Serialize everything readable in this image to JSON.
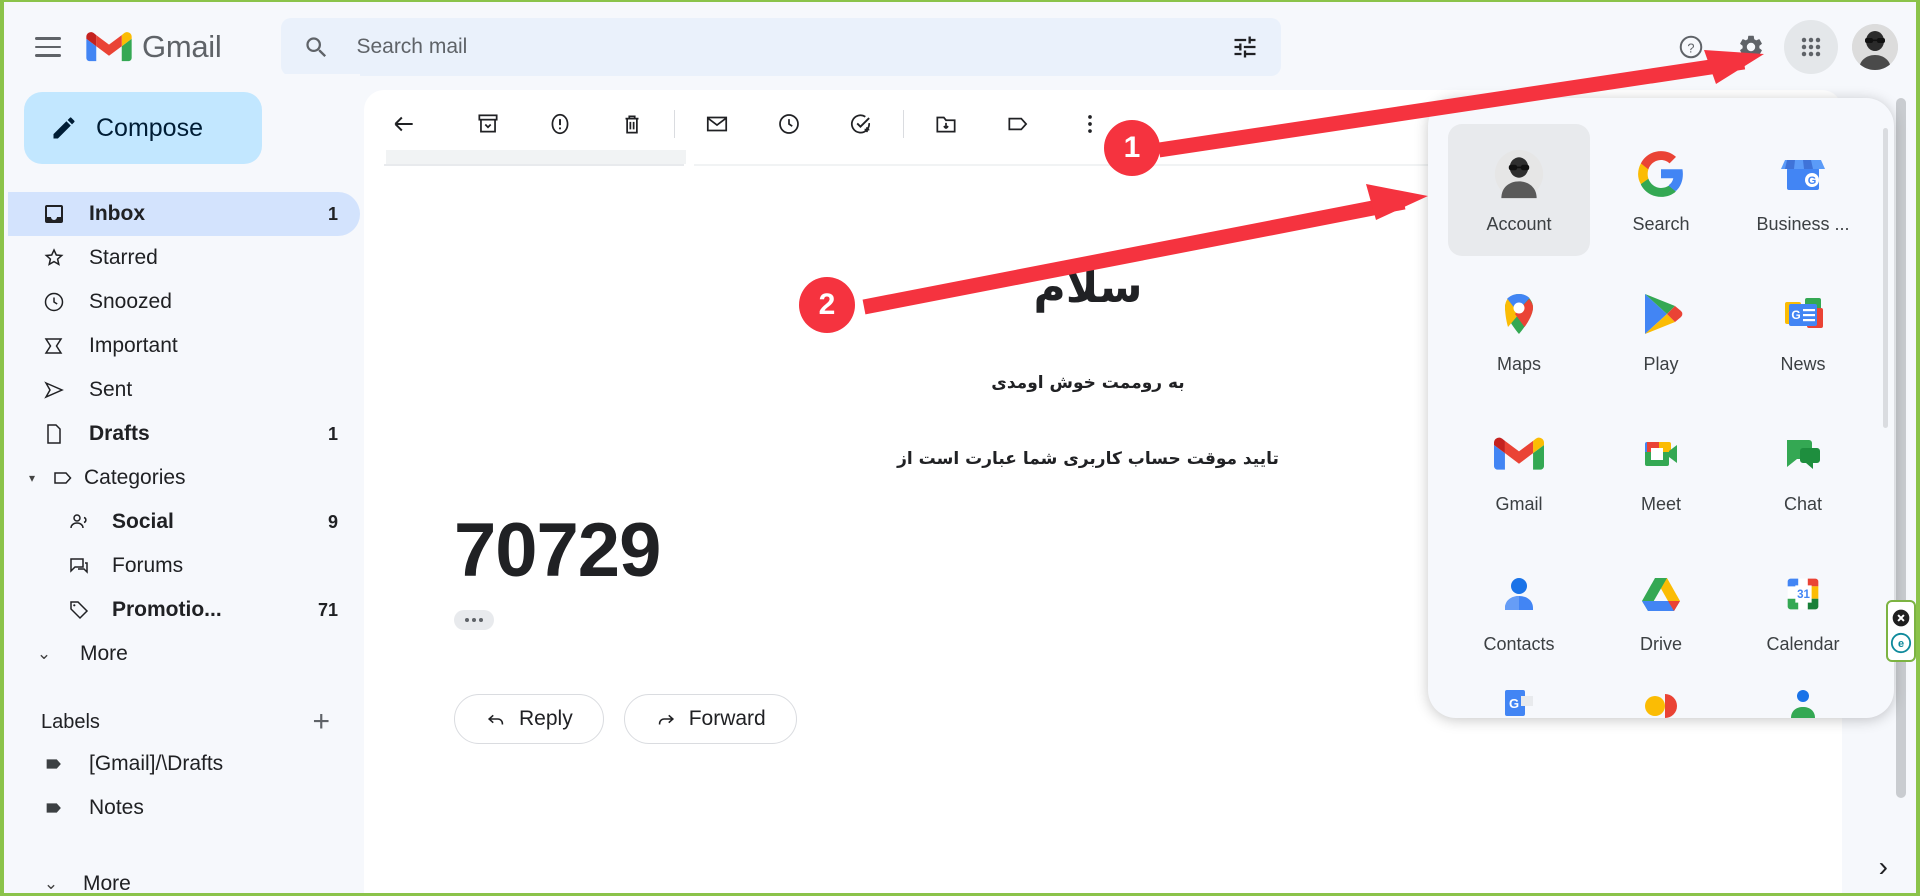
{
  "app": {
    "brand": "Gmail"
  },
  "search": {
    "placeholder": "Search mail",
    "value": ""
  },
  "header": {
    "help_icon": "help-icon",
    "settings_icon": "gear-icon",
    "apps_icon": "apps-grid-icon",
    "avatar": "user-avatar"
  },
  "sidebar": {
    "compose_label": "Compose",
    "items": [
      {
        "label": "Inbox",
        "count": "1",
        "icon": "inbox-icon",
        "selected": true,
        "bold": true
      },
      {
        "label": "Starred",
        "count": "",
        "icon": "star-icon",
        "selected": false,
        "bold": false
      },
      {
        "label": "Snoozed",
        "count": "",
        "icon": "clock-icon",
        "selected": false,
        "bold": false
      },
      {
        "label": "Important",
        "count": "",
        "icon": "important-icon",
        "selected": false,
        "bold": false
      },
      {
        "label": "Sent",
        "count": "",
        "icon": "send-icon",
        "selected": false,
        "bold": false
      },
      {
        "label": "Drafts",
        "count": "1",
        "icon": "draft-icon",
        "selected": false,
        "bold": true
      }
    ],
    "categories": {
      "label": "Categories",
      "icon": "label-icon",
      "children": [
        {
          "label": "Social",
          "count": "9",
          "icon": "people-icon",
          "bold": true
        },
        {
          "label": "Forums",
          "count": "",
          "icon": "forum-icon",
          "bold": false
        },
        {
          "label": "Promotio...",
          "count": "71",
          "icon": "promotions-icon",
          "bold": true
        }
      ]
    },
    "more_label": "More",
    "labels_title": "Labels",
    "add_label_icon": "plus-icon",
    "labels": [
      {
        "label": "[Gmail]/\\Drafts",
        "icon": "label-filled-icon"
      },
      {
        "label": "Notes",
        "icon": "label-filled-icon"
      }
    ],
    "labels_more": "More"
  },
  "toolbar": {
    "buttons": [
      {
        "name": "back-to-inbox",
        "icon": "arrow-left-icon"
      },
      {
        "name": "archive",
        "icon": "archive-icon"
      },
      {
        "name": "report-spam",
        "icon": "report-spam-icon"
      },
      {
        "name": "delete",
        "icon": "trash-icon"
      },
      {
        "name": "mark-as-unread",
        "icon": "envelope-icon"
      },
      {
        "name": "snooze",
        "icon": "clock-icon"
      },
      {
        "name": "add-to-tasks",
        "icon": "task-check-icon"
      },
      {
        "name": "move-to",
        "icon": "move-folder-icon"
      },
      {
        "name": "labels",
        "icon": "label-icon"
      },
      {
        "name": "more-options",
        "icon": "more-vertical-icon"
      }
    ]
  },
  "email": {
    "greeting": "سلام",
    "welcome": "به روممت خوش اومدی",
    "code_intro": "تایید موقت حساب کاربری شما عبارت است از",
    "code": "70729",
    "trimmed_icon": "ellipsis-icon",
    "reply_label": "Reply",
    "forward_label": "Forward",
    "reply_icon": "reply-arrow-icon",
    "forward_icon": "forward-arrow-icon"
  },
  "apps_panel": {
    "apps": [
      {
        "label": "Account",
        "icon": "account-avatar-icon",
        "selected": true
      },
      {
        "label": "Search",
        "icon": "google-g-icon",
        "selected": false
      },
      {
        "label": "Business ...",
        "icon": "business-profile-icon",
        "selected": false
      },
      {
        "label": "Maps",
        "icon": "maps-pin-icon",
        "selected": false
      },
      {
        "label": "Play",
        "icon": "play-store-icon",
        "selected": false
      },
      {
        "label": "News",
        "icon": "news-icon",
        "selected": false
      },
      {
        "label": "Gmail",
        "icon": "gmail-icon",
        "selected": false
      },
      {
        "label": "Meet",
        "icon": "meet-camera-icon",
        "selected": false
      },
      {
        "label": "Chat",
        "icon": "chat-bubble-icon",
        "selected": false
      },
      {
        "label": "Contacts",
        "icon": "contacts-person-icon",
        "selected": false
      },
      {
        "label": "Drive",
        "icon": "drive-triangle-icon",
        "selected": false
      },
      {
        "label": "Calendar",
        "icon": "calendar-31-icon",
        "selected": false
      }
    ]
  },
  "annotations": [
    {
      "number": "1",
      "target": "settings-gear-icon"
    },
    {
      "number": "2",
      "target": "account-app-tile"
    }
  ],
  "side_widget": {
    "close_icon": "close-circle-icon",
    "badge_icon": "e-badge-icon"
  },
  "bottom_nav": {
    "next_icon": "chevron-right-icon"
  },
  "colors": {
    "accent_red": "#f5333f",
    "compose_bg": "#c2e7ff",
    "selected_nav": "#d3e3fd",
    "sidebar_bg": "#f6f8fc",
    "search_bg": "#eaf1fb",
    "frame_green": "#8bc34a"
  }
}
